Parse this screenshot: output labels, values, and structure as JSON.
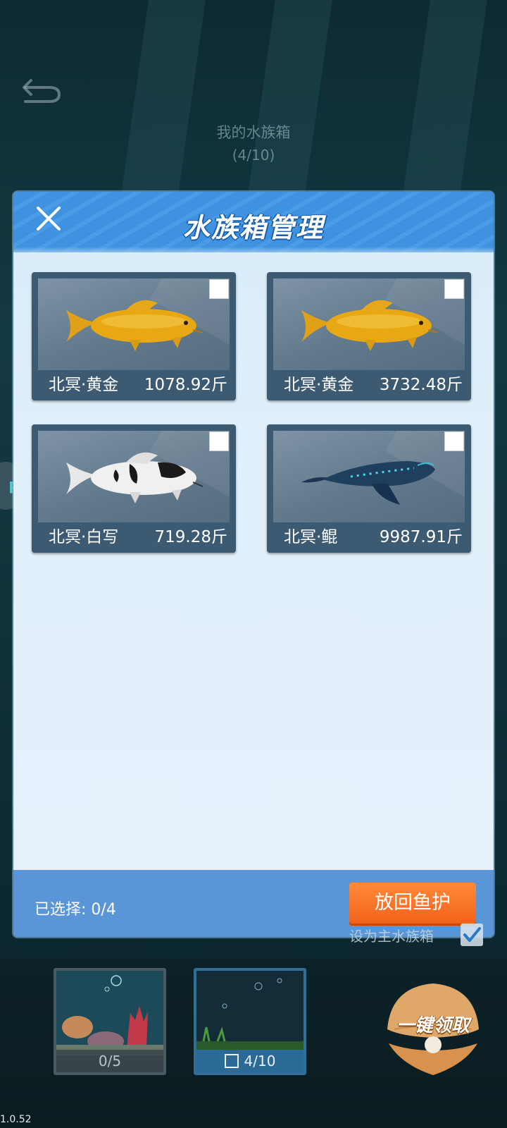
{
  "background": {
    "title": "我的水族箱",
    "count": "(4/10)",
    "side_pill_text": "p"
  },
  "modal": {
    "title": "水族箱管理",
    "fish": [
      {
        "name": "北冥·黄金",
        "weight": "1078.92斤",
        "kind": "gold-koi",
        "checked": false
      },
      {
        "name": "北冥·黄金",
        "weight": "3732.48斤",
        "kind": "gold-koi",
        "checked": false
      },
      {
        "name": "北冥·白写",
        "weight": "719.28斤",
        "kind": "shiro-utsuri-koi",
        "checked": false
      },
      {
        "name": "北冥·鲲",
        "weight": "9987.91斤",
        "kind": "kun-whale",
        "checked": false
      }
    ],
    "footer": {
      "selected_label": "已选择: 0/4",
      "release_button": "放回鱼护"
    }
  },
  "main_tank_label": "设为主水族箱",
  "tanks": [
    {
      "caption": "0/5"
    },
    {
      "caption": "4/10"
    }
  ],
  "claim_button": "一键领取",
  "version": "1.0.52"
}
